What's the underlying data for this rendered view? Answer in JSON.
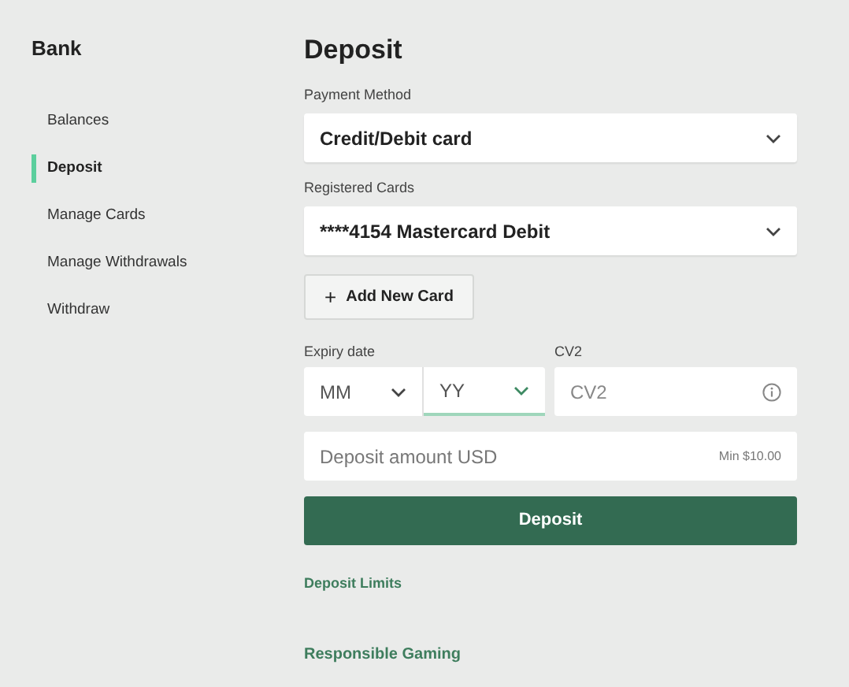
{
  "sidebar": {
    "title": "Bank",
    "items": [
      {
        "label": "Balances",
        "selected": false
      },
      {
        "label": "Deposit",
        "selected": true
      },
      {
        "label": "Manage Cards",
        "selected": false
      },
      {
        "label": "Manage Withdrawals",
        "selected": false
      },
      {
        "label": "Withdraw",
        "selected": false
      }
    ]
  },
  "main": {
    "title": "Deposit",
    "payment_method": {
      "label": "Payment Method",
      "value": "Credit/Debit card"
    },
    "registered_cards": {
      "label": "Registered Cards",
      "value": "****4154 Mastercard Debit"
    },
    "add_card_button": {
      "icon": "+",
      "label": "Add New Card"
    },
    "expiry": {
      "label": "Expiry date",
      "month": {
        "value": "MM",
        "focused": false
      },
      "year": {
        "value": "YY",
        "focused": true
      }
    },
    "cv2": {
      "label": "CV2",
      "placeholder": "CV2"
    },
    "amount": {
      "placeholder": "Deposit amount USD",
      "hint": "Min $10.00"
    },
    "submit_button": "Deposit",
    "links": [
      "Deposit Limits",
      "Responsible Gaming"
    ]
  }
}
